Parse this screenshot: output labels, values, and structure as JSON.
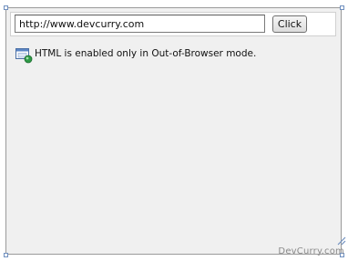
{
  "toolbar": {
    "url_value": "http://www.devcurry.com",
    "button_label": "Click"
  },
  "content": {
    "message": "HTML is enabled only in Out-of-Browser mode.",
    "message_icon": "browser-window-icon"
  },
  "watermark": "DevCurry.com",
  "colors": {
    "panel_background": "#f0f0f0",
    "panel_border": "#9a9a9a",
    "handle_border": "#6f8fbf"
  }
}
